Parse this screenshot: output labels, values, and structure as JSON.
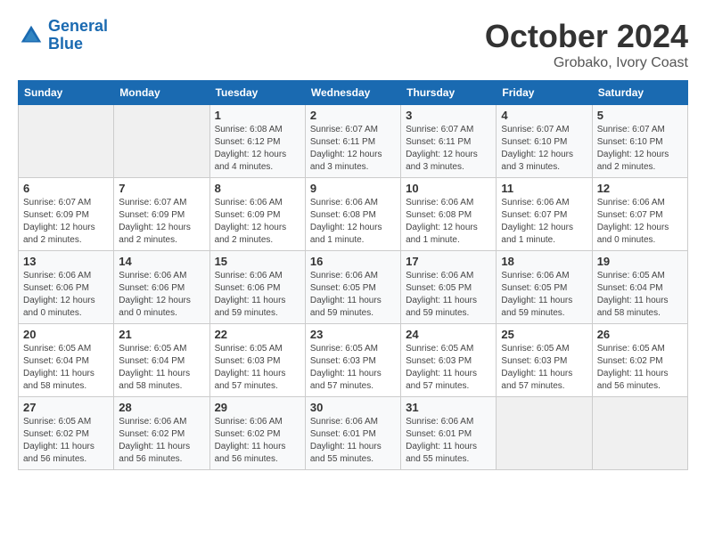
{
  "logo": {
    "line1": "General",
    "line2": "Blue"
  },
  "calendar": {
    "title": "October 2024",
    "subtitle": "Grobako, Ivory Coast"
  },
  "weekdays": [
    "Sunday",
    "Monday",
    "Tuesday",
    "Wednesday",
    "Thursday",
    "Friday",
    "Saturday"
  ],
  "weeks": [
    [
      {
        "day": "",
        "info": ""
      },
      {
        "day": "",
        "info": ""
      },
      {
        "day": "1",
        "info": "Sunrise: 6:08 AM\nSunset: 6:12 PM\nDaylight: 12 hours and 4 minutes."
      },
      {
        "day": "2",
        "info": "Sunrise: 6:07 AM\nSunset: 6:11 PM\nDaylight: 12 hours and 3 minutes."
      },
      {
        "day": "3",
        "info": "Sunrise: 6:07 AM\nSunset: 6:11 PM\nDaylight: 12 hours and 3 minutes."
      },
      {
        "day": "4",
        "info": "Sunrise: 6:07 AM\nSunset: 6:10 PM\nDaylight: 12 hours and 3 minutes."
      },
      {
        "day": "5",
        "info": "Sunrise: 6:07 AM\nSunset: 6:10 PM\nDaylight: 12 hours and 2 minutes."
      }
    ],
    [
      {
        "day": "6",
        "info": "Sunrise: 6:07 AM\nSunset: 6:09 PM\nDaylight: 12 hours and 2 minutes."
      },
      {
        "day": "7",
        "info": "Sunrise: 6:07 AM\nSunset: 6:09 PM\nDaylight: 12 hours and 2 minutes."
      },
      {
        "day": "8",
        "info": "Sunrise: 6:06 AM\nSunset: 6:09 PM\nDaylight: 12 hours and 2 minutes."
      },
      {
        "day": "9",
        "info": "Sunrise: 6:06 AM\nSunset: 6:08 PM\nDaylight: 12 hours and 1 minute."
      },
      {
        "day": "10",
        "info": "Sunrise: 6:06 AM\nSunset: 6:08 PM\nDaylight: 12 hours and 1 minute."
      },
      {
        "day": "11",
        "info": "Sunrise: 6:06 AM\nSunset: 6:07 PM\nDaylight: 12 hours and 1 minute."
      },
      {
        "day": "12",
        "info": "Sunrise: 6:06 AM\nSunset: 6:07 PM\nDaylight: 12 hours and 0 minutes."
      }
    ],
    [
      {
        "day": "13",
        "info": "Sunrise: 6:06 AM\nSunset: 6:06 PM\nDaylight: 12 hours and 0 minutes."
      },
      {
        "day": "14",
        "info": "Sunrise: 6:06 AM\nSunset: 6:06 PM\nDaylight: 12 hours and 0 minutes."
      },
      {
        "day": "15",
        "info": "Sunrise: 6:06 AM\nSunset: 6:06 PM\nDaylight: 11 hours and 59 minutes."
      },
      {
        "day": "16",
        "info": "Sunrise: 6:06 AM\nSunset: 6:05 PM\nDaylight: 11 hours and 59 minutes."
      },
      {
        "day": "17",
        "info": "Sunrise: 6:06 AM\nSunset: 6:05 PM\nDaylight: 11 hours and 59 minutes."
      },
      {
        "day": "18",
        "info": "Sunrise: 6:06 AM\nSunset: 6:05 PM\nDaylight: 11 hours and 59 minutes."
      },
      {
        "day": "19",
        "info": "Sunrise: 6:05 AM\nSunset: 6:04 PM\nDaylight: 11 hours and 58 minutes."
      }
    ],
    [
      {
        "day": "20",
        "info": "Sunrise: 6:05 AM\nSunset: 6:04 PM\nDaylight: 11 hours and 58 minutes."
      },
      {
        "day": "21",
        "info": "Sunrise: 6:05 AM\nSunset: 6:04 PM\nDaylight: 11 hours and 58 minutes."
      },
      {
        "day": "22",
        "info": "Sunrise: 6:05 AM\nSunset: 6:03 PM\nDaylight: 11 hours and 57 minutes."
      },
      {
        "day": "23",
        "info": "Sunrise: 6:05 AM\nSunset: 6:03 PM\nDaylight: 11 hours and 57 minutes."
      },
      {
        "day": "24",
        "info": "Sunrise: 6:05 AM\nSunset: 6:03 PM\nDaylight: 11 hours and 57 minutes."
      },
      {
        "day": "25",
        "info": "Sunrise: 6:05 AM\nSunset: 6:03 PM\nDaylight: 11 hours and 57 minutes."
      },
      {
        "day": "26",
        "info": "Sunrise: 6:05 AM\nSunset: 6:02 PM\nDaylight: 11 hours and 56 minutes."
      }
    ],
    [
      {
        "day": "27",
        "info": "Sunrise: 6:05 AM\nSunset: 6:02 PM\nDaylight: 11 hours and 56 minutes."
      },
      {
        "day": "28",
        "info": "Sunrise: 6:06 AM\nSunset: 6:02 PM\nDaylight: 11 hours and 56 minutes."
      },
      {
        "day": "29",
        "info": "Sunrise: 6:06 AM\nSunset: 6:02 PM\nDaylight: 11 hours and 56 minutes."
      },
      {
        "day": "30",
        "info": "Sunrise: 6:06 AM\nSunset: 6:01 PM\nDaylight: 11 hours and 55 minutes."
      },
      {
        "day": "31",
        "info": "Sunrise: 6:06 AM\nSunset: 6:01 PM\nDaylight: 11 hours and 55 minutes."
      },
      {
        "day": "",
        "info": ""
      },
      {
        "day": "",
        "info": ""
      }
    ]
  ]
}
